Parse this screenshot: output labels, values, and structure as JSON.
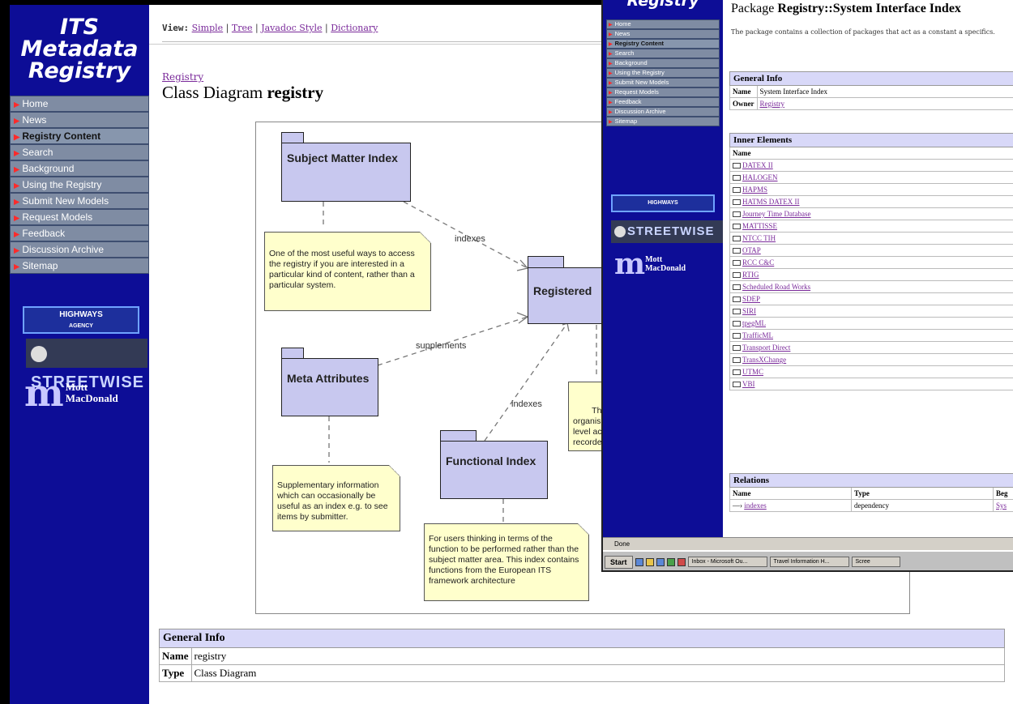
{
  "back_window": {
    "sidebar": {
      "title_lines": [
        "ITS",
        "Metadata",
        "Registry"
      ],
      "nav": [
        "Home",
        "News",
        "Registry Content",
        "Search",
        "Background",
        "Using the Registry",
        "Submit New Models",
        "Request Models",
        "Feedback",
        "Discussion Archive",
        "Sitemap"
      ],
      "active_item": "Registry Content",
      "logos": {
        "highways": "HIGHWAYS",
        "highways_sub": "AGENCY",
        "streetwise": "STREETWISE",
        "mott_line1": "Mott",
        "mott_line2": "MacDonald"
      }
    },
    "viewbar": {
      "label": "View:",
      "links": [
        "Simple",
        "Tree",
        "Javadoc Style",
        "Dictionary"
      ]
    },
    "breadcrumb": "Registry",
    "title_prefix": "Class Diagram",
    "title_name": "registry",
    "diagram": {
      "packages": {
        "subject_matter": "Subject Matter Index",
        "registered": "Registered",
        "meta": "Meta Attributes",
        "functional": "Functional Index"
      },
      "edges": {
        "indexes1": "indexes",
        "supplements": "supplements",
        "indexes2": "indexes"
      },
      "notes": {
        "subject": "One of the most useful ways to access the registry if you are interested in a particular kind of content, rather than a particular system.",
        "meta": "Supplementary information which can occasionally be useful as an index e.g. to see items by submitter.",
        "functional": "For users thinking in terms of the function to be performed rather than the subject matter area. This index contains functions from the European ITS framework architecture",
        "hierarchy": "The ho\norganis\nlevel ac\nrecorde"
      }
    },
    "general_info": {
      "header": "General Info",
      "rows": [
        [
          "Name",
          "registry"
        ],
        [
          "Type",
          "Class Diagram"
        ]
      ]
    }
  },
  "front_window": {
    "sidebar": {
      "title": "Registry",
      "nav": [
        "Home",
        "News",
        "Registry Content",
        "Search",
        "Background",
        "Using the Registry",
        "Submit New Models",
        "Request Models",
        "Feedback",
        "Discussion Archive",
        "Sitemap"
      ],
      "logos": {
        "highways": "HIGHWAYS",
        "streetwise": "STREETWISE",
        "mott_line1": "Mott",
        "mott_line2": "MacDonald"
      }
    },
    "title_prefix": "Package",
    "title_name": "Registry::System Interface Index",
    "description": "The package contains a collection of packages that act as a constant a specifics.",
    "general_info": {
      "header": "General Info",
      "name_label": "Name",
      "name_value": "System Interface Index",
      "owner_label": "Owner",
      "owner_value": "Registry"
    },
    "inner_elements": {
      "header": "Inner Elements",
      "col": "Name",
      "items": [
        "DATEX II",
        "HALOGEN",
        "HAPMS",
        "HATMS DATEX II",
        "Journey Time Database",
        "MATTISSE",
        "NTCC TIH",
        "OTAP",
        "RCC C&C",
        "RTIG",
        "Scheduled Road Works",
        "SDEP",
        "SIRI",
        "tpegML",
        "TrafficML",
        "Transport Direct",
        "TransXChange",
        "UTMC",
        "VBI"
      ]
    },
    "relations": {
      "header": "Relations",
      "cols": [
        "Name",
        "Type",
        "Beg"
      ],
      "row": [
        "indexes",
        "dependency",
        "Sys"
      ]
    },
    "status": "Done",
    "taskbar": {
      "start": "Start",
      "buttons": [
        "Inbox - Microsoft Ou...",
        "Travel Information H...",
        "Scree"
      ]
    }
  }
}
